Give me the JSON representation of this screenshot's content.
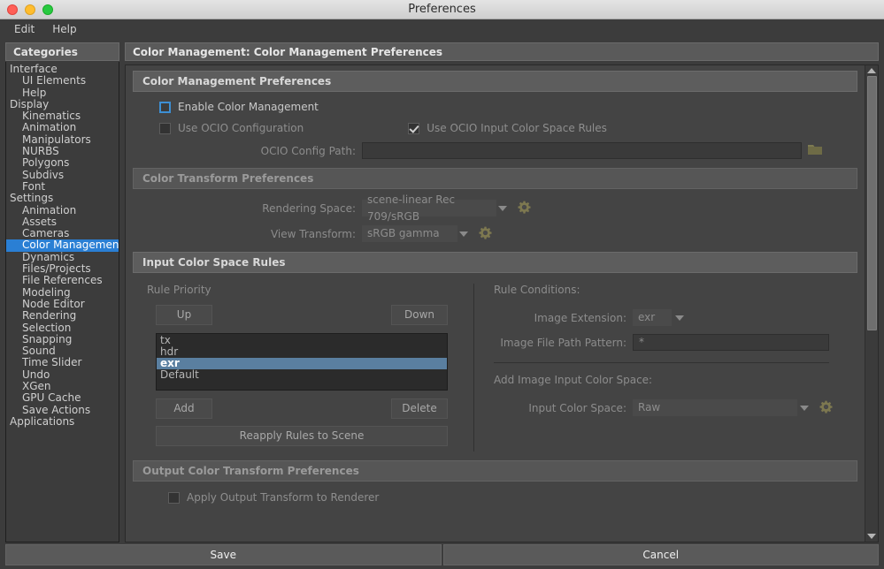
{
  "window": {
    "title": "Preferences"
  },
  "menubar": {
    "items": [
      {
        "label": "Edit"
      },
      {
        "label": "Help"
      }
    ]
  },
  "sidebar": {
    "header": "Categories",
    "items": [
      {
        "label": "Interface",
        "level": 0,
        "selected": false
      },
      {
        "label": "UI Elements",
        "level": 1,
        "selected": false
      },
      {
        "label": "Help",
        "level": 1,
        "selected": false
      },
      {
        "label": "Display",
        "level": 0,
        "selected": false
      },
      {
        "label": "Kinematics",
        "level": 1,
        "selected": false
      },
      {
        "label": "Animation",
        "level": 1,
        "selected": false
      },
      {
        "label": "Manipulators",
        "level": 1,
        "selected": false
      },
      {
        "label": "NURBS",
        "level": 1,
        "selected": false
      },
      {
        "label": "Polygons",
        "level": 1,
        "selected": false
      },
      {
        "label": "Subdivs",
        "level": 1,
        "selected": false
      },
      {
        "label": "Font",
        "level": 1,
        "selected": false
      },
      {
        "label": "Settings",
        "level": 0,
        "selected": false
      },
      {
        "label": "Animation",
        "level": 1,
        "selected": false
      },
      {
        "label": "Assets",
        "level": 1,
        "selected": false
      },
      {
        "label": "Cameras",
        "level": 1,
        "selected": false
      },
      {
        "label": "Color Management",
        "level": 1,
        "selected": true
      },
      {
        "label": "Dynamics",
        "level": 1,
        "selected": false
      },
      {
        "label": "Files/Projects",
        "level": 1,
        "selected": false
      },
      {
        "label": "File References",
        "level": 1,
        "selected": false
      },
      {
        "label": "Modeling",
        "level": 1,
        "selected": false
      },
      {
        "label": "Node Editor",
        "level": 1,
        "selected": false
      },
      {
        "label": "Rendering",
        "level": 1,
        "selected": false
      },
      {
        "label": "Selection",
        "level": 1,
        "selected": false
      },
      {
        "label": "Snapping",
        "level": 1,
        "selected": false
      },
      {
        "label": "Sound",
        "level": 1,
        "selected": false
      },
      {
        "label": "Time Slider",
        "level": 1,
        "selected": false
      },
      {
        "label": "Undo",
        "level": 1,
        "selected": false
      },
      {
        "label": "XGen",
        "level": 1,
        "selected": false
      },
      {
        "label": "GPU Cache",
        "level": 1,
        "selected": false
      },
      {
        "label": "Save Actions",
        "level": 1,
        "selected": false
      },
      {
        "label": "Applications",
        "level": 0,
        "selected": false
      }
    ]
  },
  "content": {
    "header": "Color Management: Color Management Preferences",
    "cm_section": {
      "title": "Color Management Preferences",
      "enable_label": "Enable Color Management",
      "enable_checked": false,
      "use_ocio_config_label": "Use OCIO Configuration",
      "use_ocio_config_checked": false,
      "use_ocio_rules_label": "Use OCIO Input Color Space Rules",
      "use_ocio_rules_checked": true,
      "config_path_label": "OCIO Config Path:",
      "config_path_value": "",
      "folder_icon": "folder-icon"
    },
    "transform_section": {
      "title": "Color Transform Preferences",
      "rendering_space_label": "Rendering Space:",
      "rendering_space_value": "scene-linear Rec 709/sRGB",
      "view_transform_label": "View Transform:",
      "view_transform_value": "sRGB gamma",
      "gear_icon": "gear-icon"
    },
    "rules_section": {
      "title": "Input Color Space Rules",
      "priority_label": "Rule Priority",
      "up_label": "Up",
      "down_label": "Down",
      "add_label": "Add",
      "delete_label": "Delete",
      "reapply_label": "Reapply Rules to Scene",
      "rules": [
        {
          "label": "tx",
          "selected": false
        },
        {
          "label": "hdr",
          "selected": false
        },
        {
          "label": "exr",
          "selected": true
        },
        {
          "label": "Default",
          "selected": false
        }
      ],
      "conditions_label": "Rule Conditions:",
      "image_extension_label": "Image Extension:",
      "image_extension_value": "exr",
      "file_pattern_label": "Image File Path Pattern:",
      "file_pattern_value": "*",
      "add_input_cs_label": "Add Image Input Color Space:",
      "input_cs_label": "Input Color Space:",
      "input_cs_value": "Raw",
      "gear_icon": "gear-icon"
    },
    "output_section": {
      "title": "Output Color Transform Preferences",
      "apply_output_label": "Apply Output Transform to Renderer",
      "apply_output_checked": false
    },
    "scrollbar": {
      "up_icon": "scroll-up-arrow",
      "down_icon": "scroll-down-arrow"
    }
  },
  "footer": {
    "save_label": "Save",
    "cancel_label": "Cancel"
  },
  "colors": {
    "accent_selected": "#2a7fd4",
    "list_selected": "#5a7fa0",
    "gear_olive": "#7d7850",
    "folder_olive": "#6e6b46",
    "checkbox_focus": "#3d8fd4"
  }
}
